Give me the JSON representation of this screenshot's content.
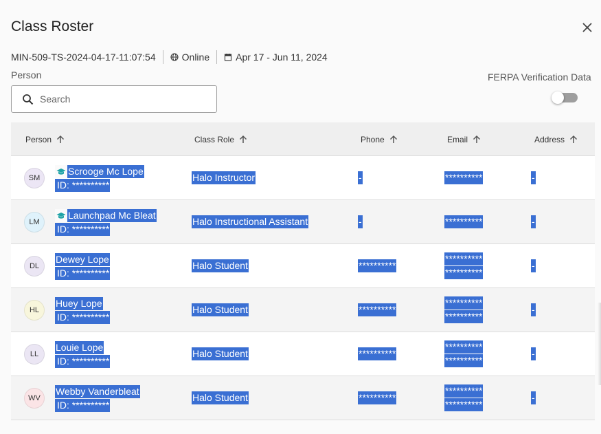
{
  "header": {
    "title": "Class Roster",
    "section_code": "MIN-509-TS-2024-04-17-11:07:54",
    "modality": "Online",
    "date_range": "Apr 17 - Jun 11, 2024"
  },
  "filters": {
    "person_label": "Person",
    "search_placeholder": "Search",
    "ferpa_label": "FERPA Verification Data",
    "ferpa_enabled": false
  },
  "columns": [
    {
      "label": "Person"
    },
    {
      "label": "Class Role"
    },
    {
      "label": "Phone"
    },
    {
      "label": "Email"
    },
    {
      "label": "Address"
    }
  ],
  "rows": [
    {
      "initials": "SM",
      "avatar_color": "#ece6f5",
      "name": "Scrooge Mc Lope",
      "instructor_icon": true,
      "id": "ID: **********",
      "role": "Halo Instructor",
      "phone": "-",
      "email": [
        "**********"
      ],
      "address": "-"
    },
    {
      "initials": "LM",
      "avatar_color": "#dff2fb",
      "name": "Launchpad Mc Bleat",
      "instructor_icon": true,
      "id": "ID: **********",
      "role": "Halo Instructional Assistant",
      "phone": "-",
      "email": [
        "**********"
      ],
      "address": "-"
    },
    {
      "initials": "DL",
      "avatar_color": "#ebe6f4",
      "name": "Dewey Lope",
      "instructor_icon": false,
      "id": "ID: **********",
      "role": "Halo Student",
      "phone": "**********",
      "email": [
        "**********",
        "**********"
      ],
      "address": "-"
    },
    {
      "initials": "HL",
      "avatar_color": "#f8f6dc",
      "name": "Huey Lope",
      "instructor_icon": false,
      "id": "ID: **********",
      "role": "Halo Student",
      "phone": "**********",
      "email": [
        "**********",
        "**********"
      ],
      "address": "-"
    },
    {
      "initials": "LL",
      "avatar_color": "#ebe6f4",
      "name": "Louie Lope",
      "instructor_icon": false,
      "id": "ID: **********",
      "role": "Halo Student",
      "phone": "**********",
      "email": [
        "**********",
        "**********"
      ],
      "address": "-"
    },
    {
      "initials": "WV",
      "avatar_color": "#fbe4e6",
      "name": "Webby Vanderbleat",
      "instructor_icon": false,
      "id": "ID: **********",
      "role": "Halo Student",
      "phone": "**********",
      "email": [
        "**********",
        "**********"
      ],
      "address": "-"
    }
  ],
  "colors": {
    "selection": "#3a6fd3",
    "instructor_icon": "#1fa3a6",
    "header_bg": "#efefef"
  }
}
